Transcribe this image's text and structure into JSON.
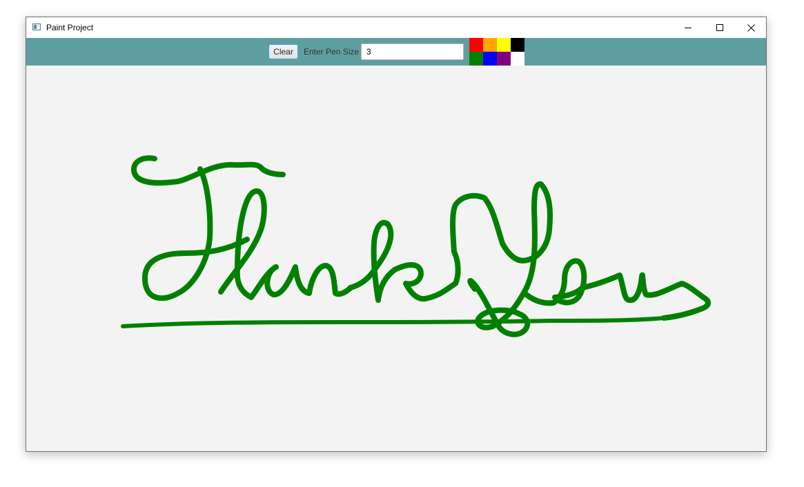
{
  "window": {
    "title": "Paint Project",
    "icon": "paint-app-icon",
    "controls": [
      "minimize-icon",
      "maximize-icon",
      "close-icon"
    ]
  },
  "toolbar": {
    "background": "#5f9ea0",
    "clear_label": "Clear",
    "pen_size_label": "Enter Pen Size",
    "pen_size_value": "3",
    "palette": [
      {
        "name": "red",
        "color": "#ff0000"
      },
      {
        "name": "orange",
        "color": "#ffa500"
      },
      {
        "name": "yellow",
        "color": "#ffff00"
      },
      {
        "name": "black",
        "color": "#000000"
      },
      {
        "name": "green",
        "color": "#008000"
      },
      {
        "name": "blue",
        "color": "#0000ff"
      },
      {
        "name": "purple",
        "color": "#800080"
      },
      {
        "name": "white",
        "color": "#ffffff"
      }
    ]
  },
  "canvas": {
    "background": "#f3f3f3",
    "stroke_color": "#008000",
    "drawing": "Thank You"
  }
}
